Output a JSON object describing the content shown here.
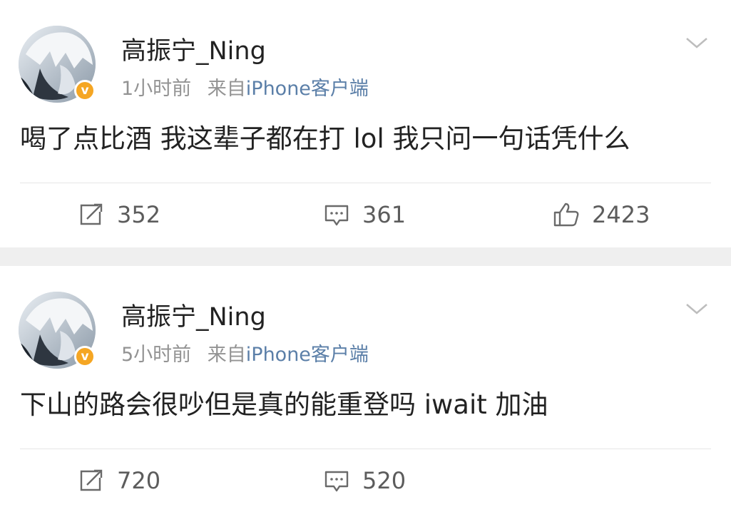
{
  "posts": [
    {
      "username": "高振宁_Ning",
      "time": "1小时前",
      "from_label": "来自",
      "source": "iPhone客户端",
      "verified_badge": "v",
      "content": "喝了点比酒 我这辈子都在打 lol  我只问一句话凭什么",
      "reposts": "352",
      "comments": "361",
      "likes": "2423"
    },
    {
      "username": "高振宁_Ning",
      "time": "5小时前",
      "from_label": "来自",
      "source": "iPhone客户端",
      "verified_badge": "v",
      "content": "下山的路会很吵但是真的能重登吗 iwait  加油",
      "reposts": "720",
      "comments": "520"
    }
  ],
  "icons": {
    "repost": "repost-icon",
    "comment": "comment-icon",
    "like": "like-icon",
    "menu": "chevron-down-icon"
  },
  "colors": {
    "source_link": "#5b7fa8",
    "verified": "#f5a623",
    "page_background": "#efefef"
  }
}
